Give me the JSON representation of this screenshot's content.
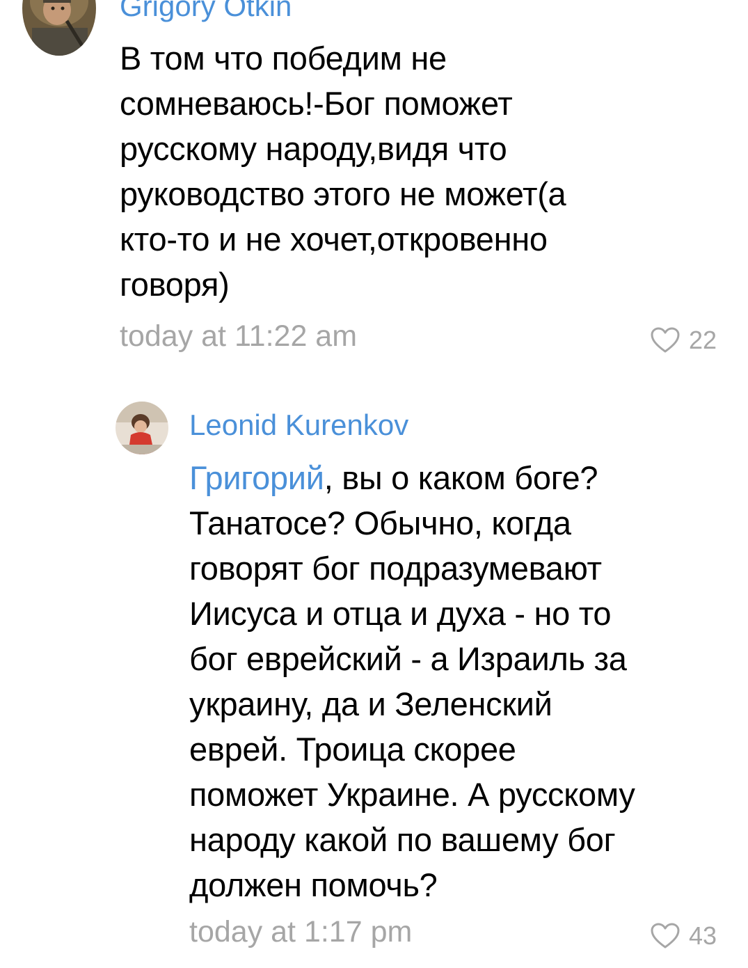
{
  "colors": {
    "link": "#4a90d9",
    "meta": "#a6a6a6",
    "text": "#000000"
  },
  "comments": [
    {
      "author": "Grigory Otkin",
      "avatar_icon": "knight-portrait-avatar",
      "text_lines": [
        "В том что победим не",
        "сомневаюсь!-Бог поможет",
        "русскому народу,видя что",
        "руководство этого не может(а",
        "кто-то и не хочет,откровенно",
        "говоря)"
      ],
      "time": "today at 11:22 am",
      "likes": "22",
      "like_icon": "heart-outline-icon"
    },
    {
      "author": "Leonid Kurenkov",
      "avatar_icon": "child-photo-avatar",
      "mention": "Григорий",
      "first_line_rest": ", вы о каком боге?",
      "text_lines": [
        "Танатосе? Обычно, когда",
        "говорят бог подразумевают",
        "Иисуса и отца и духа - но то",
        "бог еврейский - а Израиль за",
        "украину, да и Зеленский",
        "еврей. Троица скорее",
        "поможет Украине. А русскому",
        "народу какой по вашему бог",
        "должен помочь?"
      ],
      "time": "today at 1:17 pm",
      "likes": "43",
      "like_icon": "heart-outline-icon"
    }
  ]
}
